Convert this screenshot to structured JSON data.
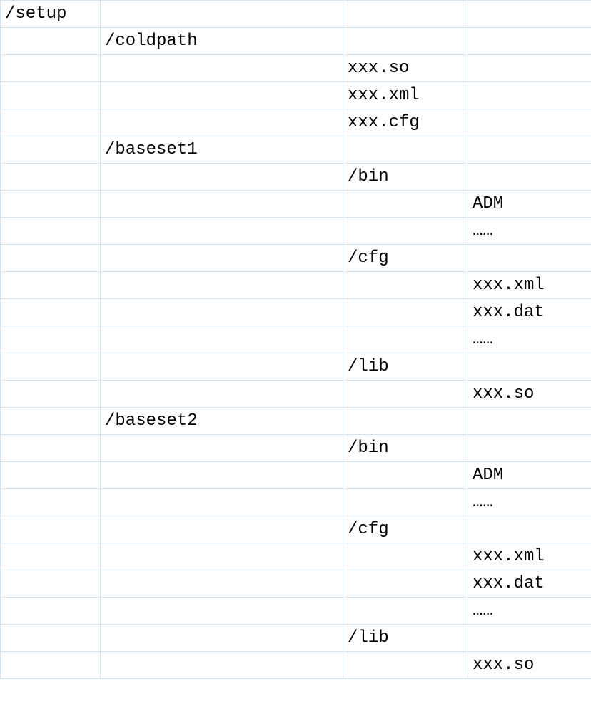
{
  "rows": [
    {
      "c1": "/setup",
      "c2": "",
      "c3": "",
      "c4": ""
    },
    {
      "c1": "",
      "c2": "/coldpath",
      "c3": "",
      "c4": ""
    },
    {
      "c1": "",
      "c2": "",
      "c3": "xxx.so",
      "c4": ""
    },
    {
      "c1": "",
      "c2": "",
      "c3": "xxx.xml",
      "c4": ""
    },
    {
      "c1": "",
      "c2": "",
      "c3": "xxx.cfg",
      "c4": ""
    },
    {
      "c1": "",
      "c2": "/baseset1",
      "c3": "",
      "c4": ""
    },
    {
      "c1": "",
      "c2": "",
      "c3": "/bin",
      "c4": ""
    },
    {
      "c1": "",
      "c2": "",
      "c3": "",
      "c4": "ADM"
    },
    {
      "c1": "",
      "c2": "",
      "c3": "",
      "c4": "……"
    },
    {
      "c1": "",
      "c2": "",
      "c3": "/cfg",
      "c4": ""
    },
    {
      "c1": "",
      "c2": "",
      "c3": "",
      "c4": "xxx.xml"
    },
    {
      "c1": "",
      "c2": "",
      "c3": "",
      "c4": "xxx.dat"
    },
    {
      "c1": "",
      "c2": "",
      "c3": "",
      "c4": "……"
    },
    {
      "c1": "",
      "c2": "",
      "c3": "/lib",
      "c4": ""
    },
    {
      "c1": "",
      "c2": "",
      "c3": "",
      "c4": "xxx.so"
    },
    {
      "c1": "",
      "c2": "/baseset2",
      "c3": "",
      "c4": ""
    },
    {
      "c1": "",
      "c2": "",
      "c3": "/bin",
      "c4": ""
    },
    {
      "c1": "",
      "c2": "",
      "c3": "",
      "c4": "ADM"
    },
    {
      "c1": "",
      "c2": "",
      "c3": "",
      "c4": "……"
    },
    {
      "c1": "",
      "c2": "",
      "c3": "/cfg",
      "c4": ""
    },
    {
      "c1": "",
      "c2": "",
      "c3": "",
      "c4": "xxx.xml"
    },
    {
      "c1": "",
      "c2": "",
      "c3": "",
      "c4": "xxx.dat"
    },
    {
      "c1": "",
      "c2": "",
      "c3": "",
      "c4": "……"
    },
    {
      "c1": "",
      "c2": "",
      "c3": "/lib",
      "c4": ""
    },
    {
      "c1": "",
      "c2": "",
      "c3": "",
      "c4": "xxx.so"
    }
  ]
}
